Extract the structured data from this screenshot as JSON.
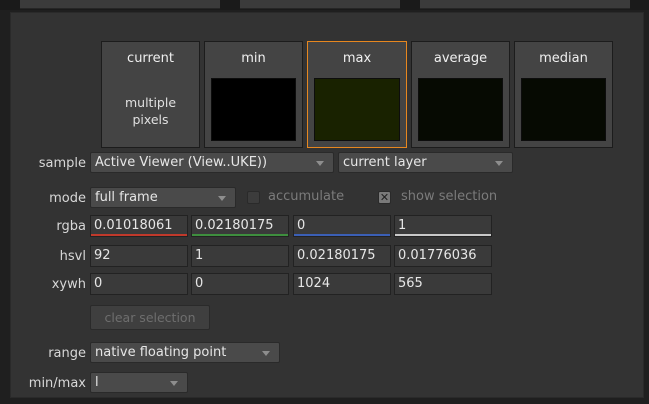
{
  "swatches": [
    {
      "title": "current",
      "note_line1": "multiple",
      "note_line2": "pixels",
      "color": "#444444",
      "selected": false
    },
    {
      "title": "min",
      "color": "#000000",
      "selected": false
    },
    {
      "title": "max",
      "color": "#192200",
      "selected": true
    },
    {
      "title": "average",
      "color": "#060a02",
      "selected": false
    },
    {
      "title": "median",
      "color": "#060a02",
      "selected": false
    }
  ],
  "controls": {
    "sample": {
      "label": "sample",
      "value": "Active Viewer (View..UKE))",
      "layer": "current layer"
    },
    "mode": {
      "label": "mode",
      "value": "full frame",
      "accumulate_label": "accumulate",
      "accumulate_checked": false,
      "show_selection_label": "show selection",
      "show_selection_checked": true
    },
    "rgba": {
      "label": "rgba",
      "values": [
        "0.01018061",
        "0.02180175",
        "0",
        "1"
      ],
      "colors": [
        "#c0392b",
        "#3e8e3e",
        "#3b5fb5",
        "#c8c8c8"
      ]
    },
    "hsvl": {
      "label": "hsvl",
      "values": [
        "92",
        "1",
        "0.02180175",
        "0.01776036"
      ]
    },
    "xywh": {
      "label": "xywh",
      "values": [
        "0",
        "0",
        "1024",
        "565"
      ]
    },
    "clear_selection": "clear selection",
    "range": {
      "label": "range",
      "value": "native floating point"
    },
    "minmax": {
      "label": "min/max",
      "value": "l"
    }
  },
  "accent_color": "#e7871f"
}
